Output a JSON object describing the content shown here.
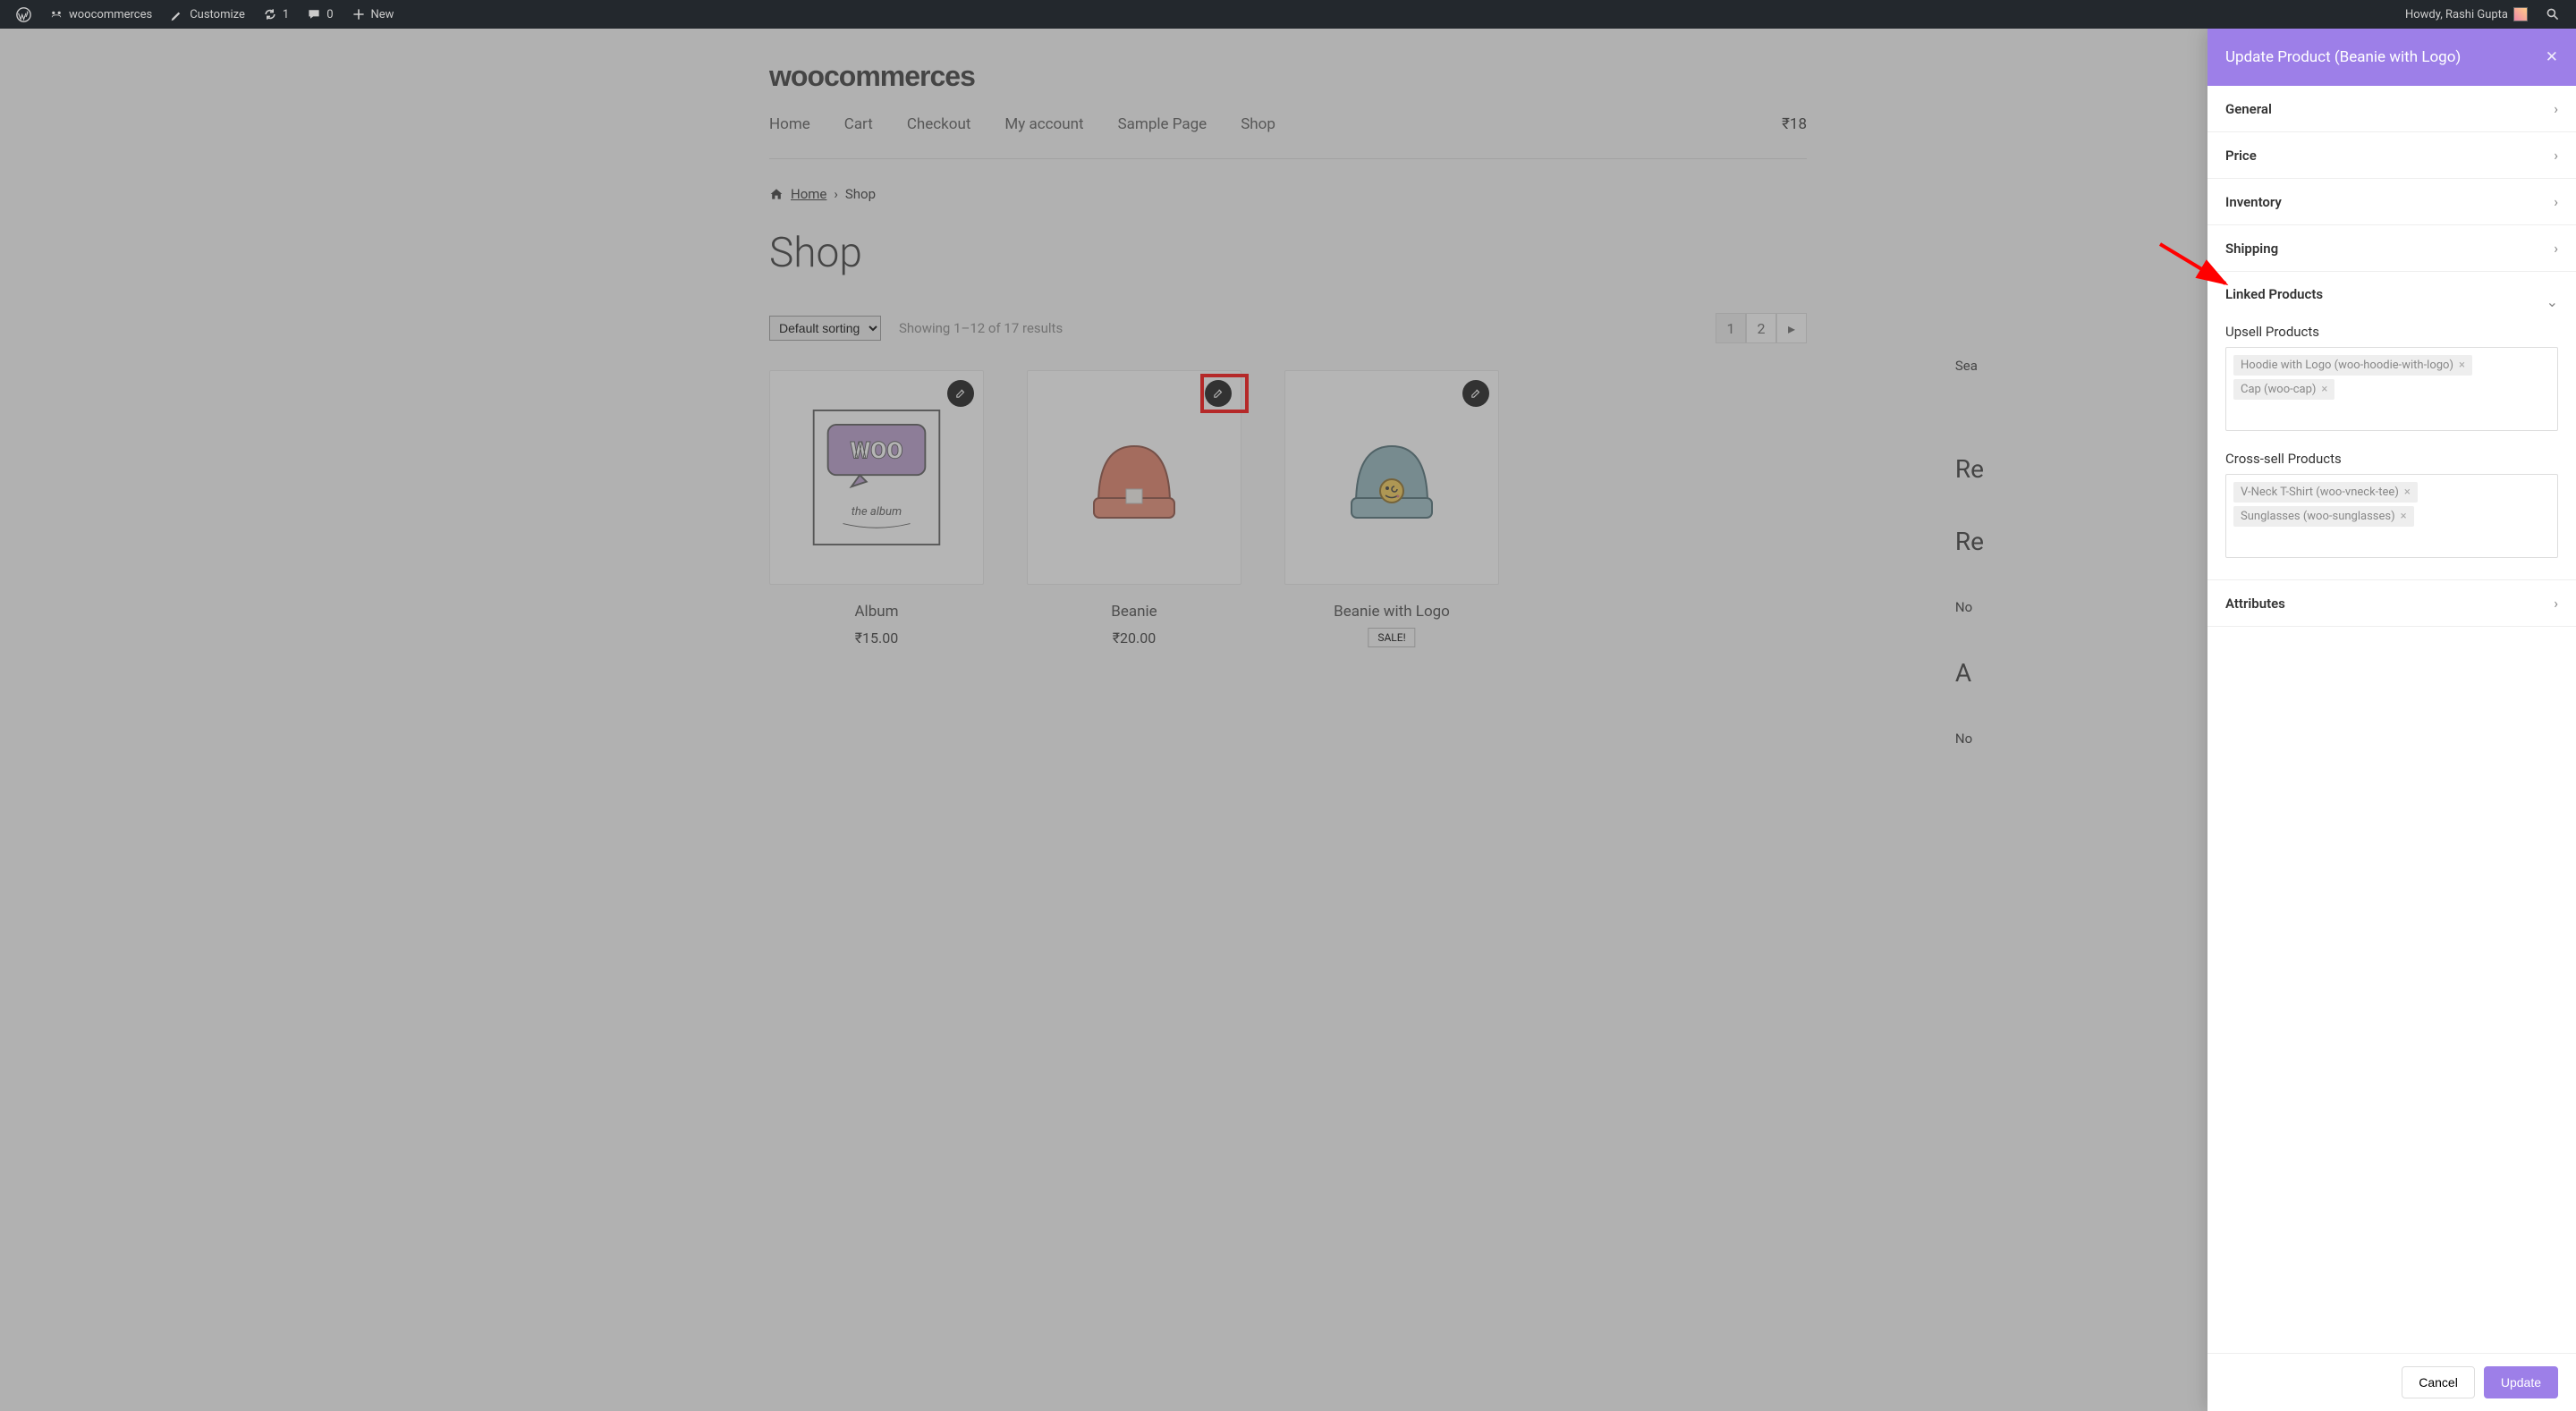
{
  "adminbar": {
    "site": "woocommerces",
    "customize": "Customize",
    "updates": "1",
    "comments": "0",
    "new": "New",
    "howdy": "Howdy, Rashi Gupta"
  },
  "site": {
    "title": "woocommerces"
  },
  "nav": [
    "Home",
    "Cart",
    "Checkout",
    "My account",
    "Sample Page",
    "Shop"
  ],
  "cart": "₹18",
  "breadcrumb": {
    "home": "Home",
    "current": "Shop"
  },
  "shop": {
    "heading": "Shop",
    "sort": "Default sorting",
    "results": "Showing 1–12 of 17 results",
    "pages": [
      "1",
      "2"
    ]
  },
  "products": [
    {
      "name": "Album",
      "price": "₹15.00",
      "sale": false
    },
    {
      "name": "Beanie",
      "price": "₹20.00",
      "sale": false
    },
    {
      "name": "Beanie with Logo",
      "price": "",
      "sale": true,
      "saleText": "SALE!"
    }
  ],
  "sidebarPeek": {
    "search": "Sea",
    "r1": "Re",
    "r2": "Re",
    "no1": "No",
    "a": "A",
    "no2": "No"
  },
  "panel": {
    "title": "Update Product (Beanie with Logo)",
    "sections": {
      "general": "General",
      "price": "Price",
      "inventory": "Inventory",
      "shipping": "Shipping",
      "linked": "Linked Products",
      "attributes": "Attributes"
    },
    "linked": {
      "upsellLabel": "Upsell Products",
      "upsells": [
        "Hoodie with Logo (woo-hoodie-with-logo)",
        "Cap (woo-cap)"
      ],
      "crossLabel": "Cross-sell Products",
      "cross": [
        "V-Neck T-Shirt (woo-vneck-tee)",
        "Sunglasses (woo-sunglasses)"
      ]
    },
    "cancel": "Cancel",
    "update": "Update"
  }
}
